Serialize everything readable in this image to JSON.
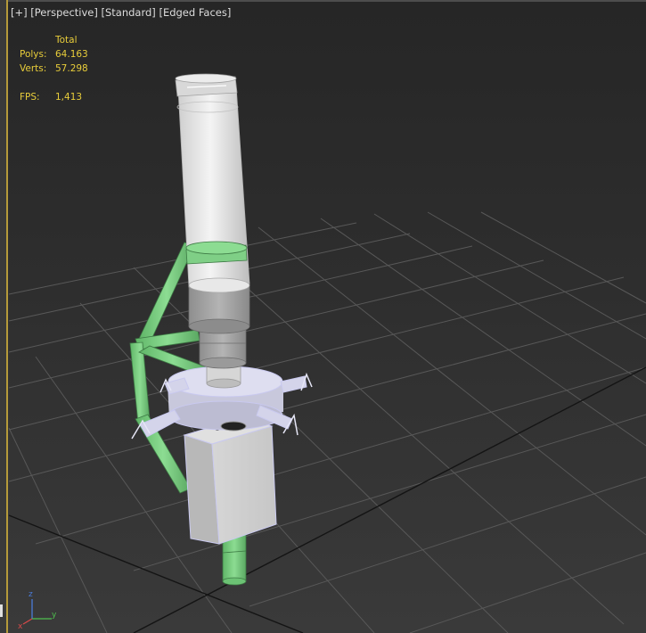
{
  "viewport_label": {
    "plus": "[+]",
    "view": "[Perspective]",
    "shading": "[Standard]",
    "display": "[Edged Faces]"
  },
  "stats": {
    "header": "Total",
    "polys_label": "Polys:",
    "polys_value": "64.163",
    "verts_label": "Verts:",
    "verts_value": "57.298",
    "fps_label": "FPS:",
    "fps_value": "1,413"
  },
  "axis_gizmo": {
    "x": "x",
    "y": "y",
    "z": "z"
  },
  "colors": {
    "stats_text": "#e8cd3a",
    "grid_line": "#5a5a5a",
    "grid_axis": "#141414",
    "frame_accent": "#b59a3a",
    "model_white": "#e6e6e6",
    "model_green": "#7fcf86",
    "selection_lavender": "#c9c9ef"
  }
}
